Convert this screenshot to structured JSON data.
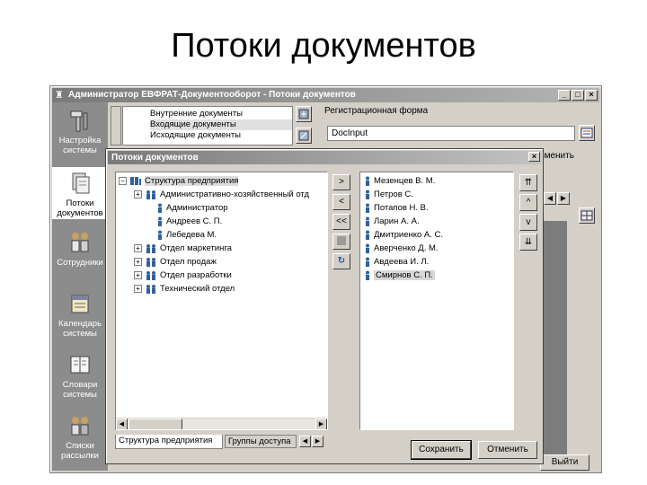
{
  "slide": {
    "title": "Потоки документов"
  },
  "app": {
    "title": "Администратор ЕВФРАТ-Документооборот - Потоки документов",
    "window_buttons": [
      "_",
      "□",
      "×"
    ]
  },
  "sidebar": {
    "items": [
      {
        "label": "Настройка системы",
        "icon": "tools-icon"
      },
      {
        "label": "Потоки документов",
        "icon": "documents-icon",
        "active": true
      },
      {
        "label": "Сотрудники",
        "icon": "people-icon"
      },
      {
        "label": "Календарь системы",
        "icon": "calendar-icon"
      },
      {
        "label": "Словари системы",
        "icon": "dictionary-icon"
      },
      {
        "label": "Списки рассылки",
        "icon": "mailing-list-icon"
      }
    ]
  },
  "background": {
    "doc_types": [
      "Внутренние документы",
      "Входящие документы",
      "Исходящие документы"
    ],
    "reg_form_label": "Регистрационная форма",
    "doc_input_value": "DocInput",
    "right_text": "зменить",
    "exit_label": "Выйти"
  },
  "dialog": {
    "title": "Потоки документов",
    "close": "×",
    "tree": {
      "root": "Структура предприятия",
      "nodes": [
        {
          "label": "Административно-хозяйственный отд",
          "expandable": true,
          "type": "group"
        },
        {
          "label": "Администратор",
          "expandable": false,
          "type": "person"
        },
        {
          "label": "Андреев С. П.",
          "expandable": false,
          "type": "person"
        },
        {
          "label": "Лебедева М.",
          "expandable": false,
          "type": "person"
        },
        {
          "label": "Отдел маркетинга",
          "expandable": true,
          "type": "group"
        },
        {
          "label": "Отдел продаж",
          "expandable": true,
          "type": "group"
        },
        {
          "label": "Отдел разработки",
          "expandable": true,
          "type": "group"
        },
        {
          "label": "Технический отдел",
          "expandable": true,
          "type": "group"
        }
      ]
    },
    "move_buttons": [
      ">",
      "<",
      "<<",
      "",
      "↻"
    ],
    "employees": [
      "Мезенцев В. М.",
      "Петров С.",
      "Потапов Н. В.",
      "Ларин А. А.",
      "Дмитриенко А. С.",
      "Аверченко Д. М.",
      "Авдеева И. Л.",
      "Смирнов С. П."
    ],
    "selected_employee": "Смирнов С. П.",
    "order_buttons": [
      "⇈",
      "^",
      "v",
      "⇊"
    ],
    "tabs": [
      "Структура предприятия",
      "Группы доступа"
    ],
    "save_label": "Сохранить",
    "cancel_label": "Отменить"
  },
  "colors": {
    "window_bg": "#d4d0c8",
    "sidebar_bg": "#8c8c8c",
    "titlebar": "#7a7a7a"
  }
}
